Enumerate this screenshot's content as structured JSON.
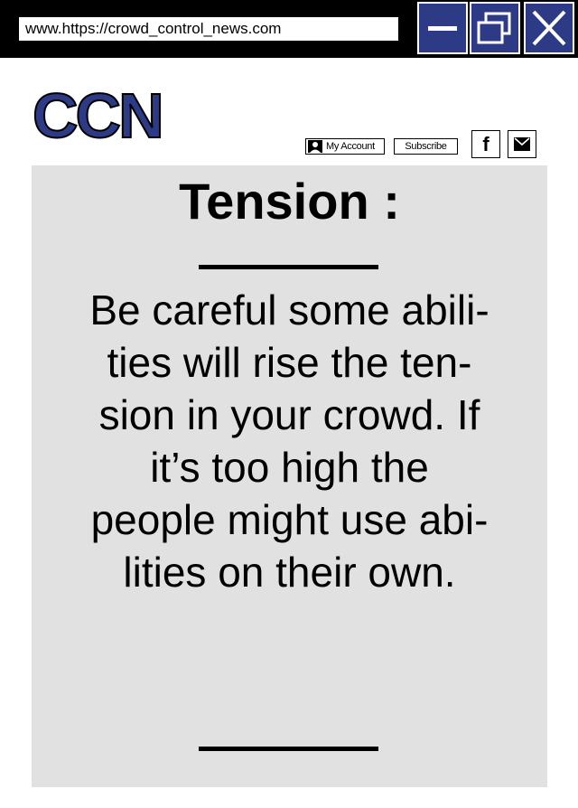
{
  "browser": {
    "url": "www.https://crowd_control_news.com",
    "controls": {
      "minimize_icon": "minimize-icon",
      "maximize_icon": "restore-icon",
      "close_icon": "close-icon",
      "button_color": "#2d3a86"
    }
  },
  "site": {
    "logo": "CCN",
    "brand_color": "#2d3a86"
  },
  "header": {
    "account_label": "My Account",
    "account_icon": "person-icon",
    "subscribe_label": "Subscribe",
    "facebook_glyph": "f",
    "mail_icon": "mail-icon"
  },
  "article": {
    "title": "Tension :",
    "body": "Be careful some abili-\nties will rise the ten-\nsion in your crowd. If\nit’s too high the\npeople might use abi-\nlities on their own.",
    "panel_color": "#e1e1e1"
  }
}
